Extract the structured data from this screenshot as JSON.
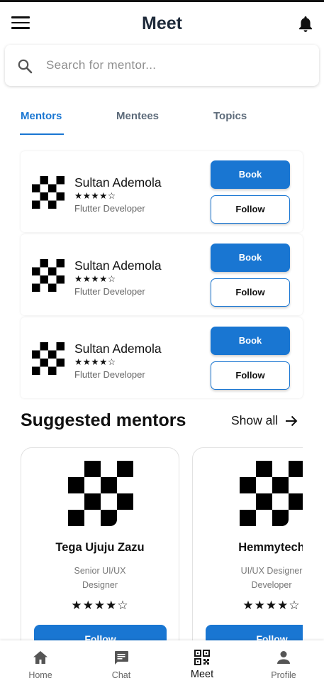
{
  "app": {
    "title": "Meet"
  },
  "search": {
    "placeholder": "Search for mentor..."
  },
  "tabs": [
    {
      "label": "Mentors",
      "active": true
    },
    {
      "label": "Mentees",
      "active": false
    },
    {
      "label": "Topics",
      "active": false
    }
  ],
  "mentors": [
    {
      "name": "Sultan Ademola",
      "stars": "★★★★☆",
      "role": "Flutter Developer",
      "book_label": "Book",
      "follow_label": "Follow"
    },
    {
      "name": "Sultan Ademola",
      "stars": "★★★★☆",
      "role": "Flutter Developer",
      "book_label": "Book",
      "follow_label": "Follow"
    },
    {
      "name": "Sultan Ademola",
      "stars": "★★★★☆",
      "role": "Flutter Developer",
      "book_label": "Book",
      "follow_label": "Follow"
    }
  ],
  "suggested": {
    "title": "Suggested mentors",
    "show_all_label": "Show all",
    "cards": [
      {
        "name": "Tega Ujuju Zazu",
        "role": "Senior UI/UX Designer",
        "stars": "★★★★☆",
        "follow_label": "Follow"
      },
      {
        "name": "Hemmytech",
        "role": "UI/UX Designer Developer",
        "stars": "★★★★☆",
        "follow_label": "Follow"
      }
    ]
  },
  "bottom_nav": [
    {
      "label": "Home",
      "icon": "home-icon",
      "active": false
    },
    {
      "label": "Chat",
      "icon": "chat-icon",
      "active": false
    },
    {
      "label": "Meet",
      "icon": "qr-code-icon",
      "active": true
    },
    {
      "label": "Profile",
      "icon": "person-icon",
      "active": false
    }
  ],
  "colors": {
    "accent": "#1976d2",
    "title": "#1e2a3a",
    "tab_inactive": "#5d6b7a"
  }
}
